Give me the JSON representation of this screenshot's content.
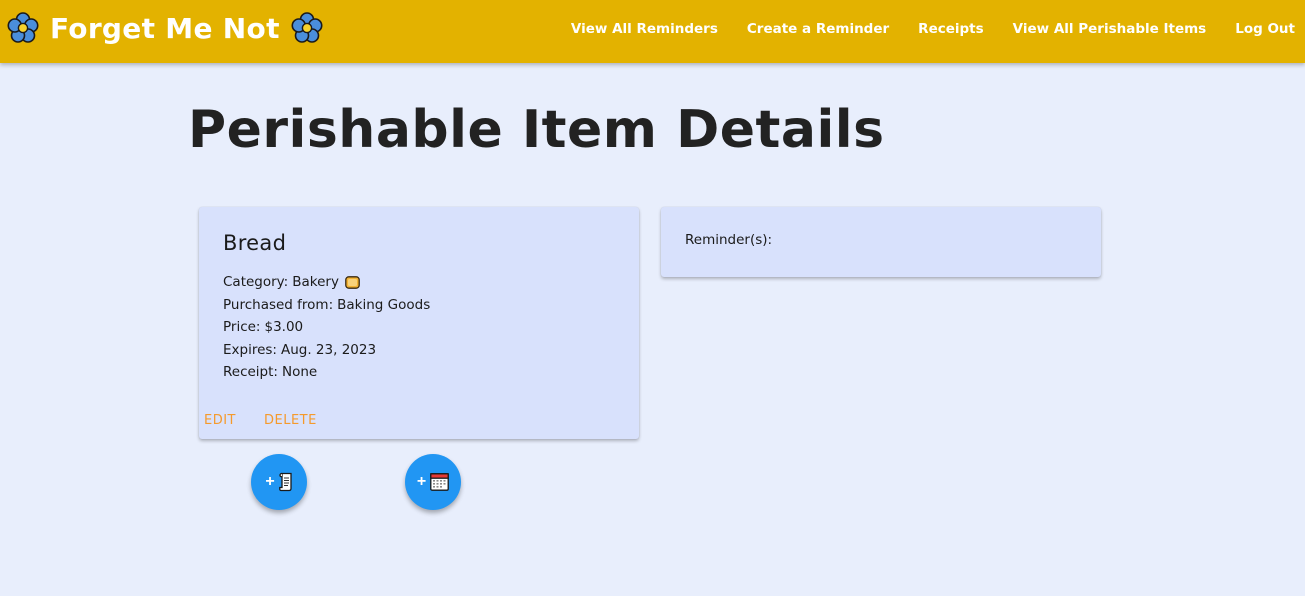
{
  "navbar": {
    "brand_title": "Forget Me Not",
    "brand_icon_left": "flower-icon",
    "brand_icon_right": "flower-icon",
    "links": [
      "View All Reminders",
      "Create a Reminder",
      "Receipts",
      "View All Perishable Items",
      "Log Out"
    ],
    "background_color": "#E3B200"
  },
  "page": {
    "title": "Perishable Item Details",
    "background_color": "#E8EEFC"
  },
  "item": {
    "name": "Bread",
    "category_label": "Category:",
    "category_value": "Bakery",
    "category_icon": "bread-icon",
    "purchased_label": "Purchased from:",
    "purchased_value": "Baking Goods",
    "price_label": "Price:",
    "price_value": "$3.00",
    "expires_label": "Expires:",
    "expires_value": "Aug. 23, 2023",
    "receipt_label": "Receipt:",
    "receipt_value": "None",
    "actions": {
      "edit_label": "Edit",
      "delete_label": "Delete"
    },
    "card_color": "#D8E1FC",
    "action_color": "#F59A2C"
  },
  "reminders": {
    "label": "Reminder(s):"
  },
  "fab": {
    "add_receipt": {
      "plus": "+",
      "icon": "scroll-icon"
    },
    "add_reminder": {
      "plus": "+",
      "icon": "calendar-icon"
    },
    "color": "#2196F3"
  }
}
